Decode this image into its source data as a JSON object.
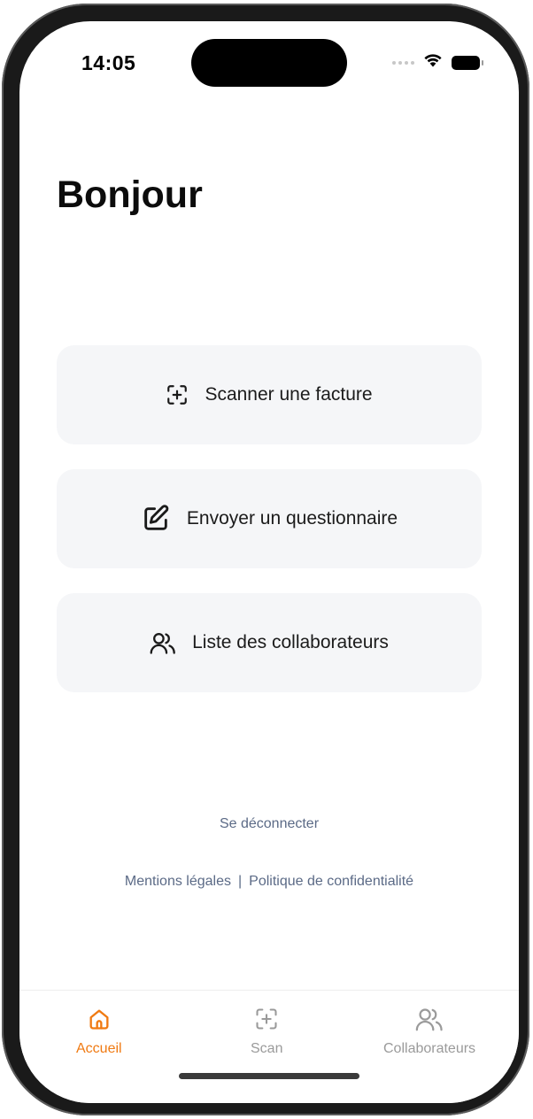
{
  "status_bar": {
    "time": "14:05"
  },
  "greeting": "Bonjour",
  "actions": [
    {
      "label": "Scanner une facture",
      "icon": "scan-icon"
    },
    {
      "label": "Envoyer un questionnaire",
      "icon": "edit-icon"
    },
    {
      "label": "Liste des collaborateurs",
      "icon": "users-icon"
    }
  ],
  "logout_label": "Se déconnecter",
  "legal": {
    "mentions": "Mentions légales",
    "separator": "|",
    "privacy": "Politique de confidentialité"
  },
  "tabbar": {
    "tabs": [
      {
        "label": "Accueil",
        "icon": "home-icon",
        "active": true
      },
      {
        "label": "Scan",
        "icon": "scan-icon",
        "active": false
      },
      {
        "label": "Collaborateurs",
        "icon": "users-icon",
        "active": false
      }
    ]
  },
  "colors": {
    "accent": "#f07a12",
    "link": "#5b6a86",
    "card_bg": "#f5f6f8",
    "inactive_tab": "#9a9a9a"
  }
}
